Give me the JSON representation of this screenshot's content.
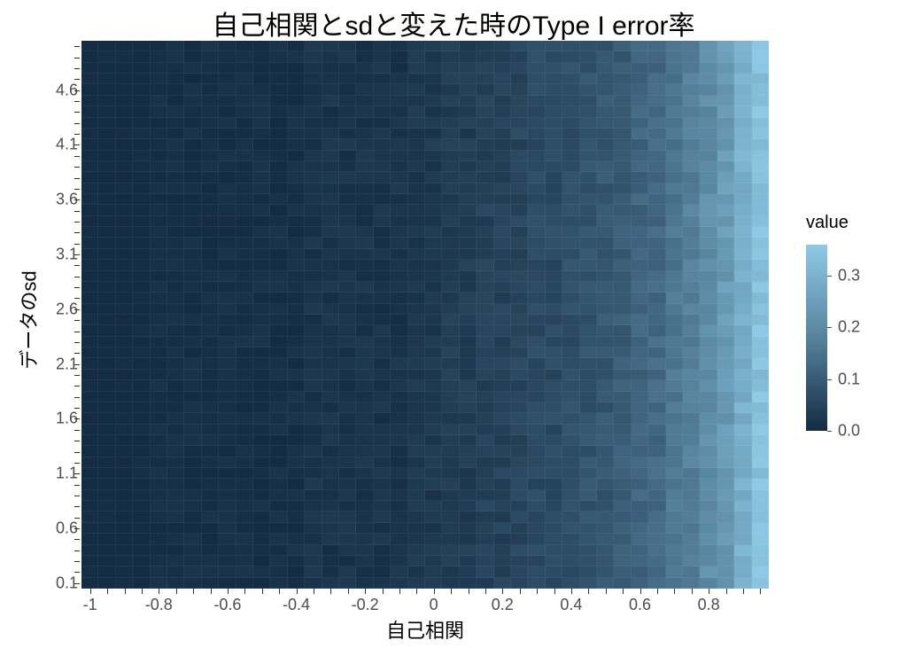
{
  "chart_data": {
    "type": "heatmap",
    "title": "自己相関とsdと変えた時のType I error率",
    "xlabel": "自己相関",
    "ylabel": "データのsd",
    "xlim": [
      -1,
      1
    ],
    "ylim": [
      0.1,
      5.0
    ],
    "x": [
      -1.0,
      -0.95,
      -0.9,
      -0.85,
      -0.8,
      -0.75,
      -0.7,
      -0.65,
      -0.6,
      -0.55,
      -0.5,
      -0.45,
      -0.4,
      -0.35,
      -0.3,
      -0.25,
      -0.2,
      -0.15,
      -0.1,
      -0.05,
      0.0,
      0.05,
      0.1,
      0.15,
      0.2,
      0.25,
      0.3,
      0.35,
      0.4,
      0.45,
      0.5,
      0.55,
      0.6,
      0.65,
      0.7,
      0.75,
      0.8,
      0.85,
      0.9,
      0.95
    ],
    "y": [
      0.1,
      0.2,
      0.3,
      0.4,
      0.5,
      0.6,
      0.7,
      0.8,
      0.9,
      1.0,
      1.1,
      1.2,
      1.3,
      1.4,
      1.5,
      1.6,
      1.7,
      1.8,
      1.9,
      2.0,
      2.1,
      2.2,
      2.3,
      2.4,
      2.5,
      2.6,
      2.7,
      2.8,
      2.9,
      3.0,
      3.1,
      3.2,
      3.3,
      3.4,
      3.5,
      3.6,
      3.7,
      3.8,
      3.9,
      4.0,
      4.1,
      4.2,
      4.3,
      4.4,
      4.5,
      4.6,
      4.7,
      4.8,
      4.9,
      5.0
    ],
    "value_profile_by_x": [
      0.0,
      0.0,
      0.0,
      0.0,
      0.01,
      0.01,
      0.01,
      0.01,
      0.01,
      0.01,
      0.01,
      0.01,
      0.01,
      0.02,
      0.02,
      0.02,
      0.02,
      0.02,
      0.02,
      0.03,
      0.03,
      0.04,
      0.04,
      0.05,
      0.05,
      0.06,
      0.07,
      0.07,
      0.08,
      0.09,
      0.1,
      0.11,
      0.13,
      0.14,
      0.17,
      0.19,
      0.22,
      0.25,
      0.3,
      0.34
    ],
    "note": "Each cell value ≈ value_profile_by_x[column] with small random noise (±0.02); rows are approximately constant.",
    "x_tick_labels": [
      "-1",
      "-0.8",
      "-0.6",
      "-0.4",
      "-0.2",
      "0",
      "0.2",
      "0.4",
      "0.6",
      "0.8"
    ],
    "y_tick_labels": [
      "0.1",
      "0.6",
      "1.1",
      "1.6",
      "2.1",
      "2.6",
      "3.1",
      "3.6",
      "4.1",
      "4.6"
    ],
    "legend": {
      "title": "value",
      "range": [
        0.0,
        0.36
      ],
      "ticks": [
        0.0,
        0.1,
        0.2,
        0.3
      ],
      "gradient_low": "#132B43",
      "gradient_high": "#8ecae6"
    }
  }
}
